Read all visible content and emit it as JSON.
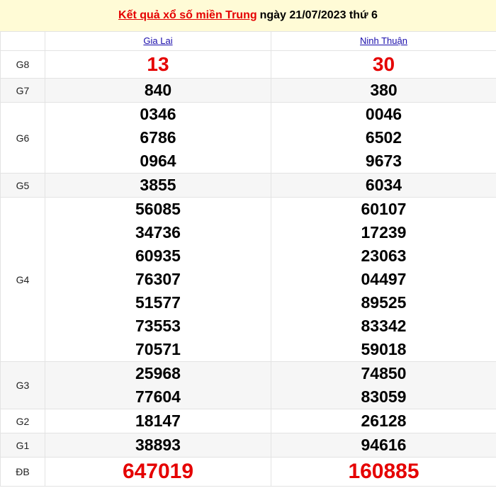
{
  "header": {
    "title_link": "Kết quả xổ số miền Trung",
    "title_rest": "ngày 21/07/2023 thứ 6"
  },
  "provinces": [
    "Gia Lai",
    "Ninh Thuận"
  ],
  "rows": [
    {
      "label": "G8",
      "a": [
        "13"
      ],
      "b": [
        "30"
      ]
    },
    {
      "label": "G7",
      "a": [
        "840"
      ],
      "b": [
        "380"
      ]
    },
    {
      "label": "G6",
      "a": [
        "0346",
        "6786",
        "0964"
      ],
      "b": [
        "0046",
        "6502",
        "9673"
      ]
    },
    {
      "label": "G5",
      "a": [
        "3855"
      ],
      "b": [
        "6034"
      ]
    },
    {
      "label": "G4",
      "a": [
        "56085",
        "34736",
        "60935",
        "76307",
        "51577",
        "73553",
        "70571"
      ],
      "b": [
        "60107",
        "17239",
        "23063",
        "04497",
        "89525",
        "83342",
        "59018"
      ]
    },
    {
      "label": "G3",
      "a": [
        "25968",
        "77604"
      ],
      "b": [
        "74850",
        "83059"
      ]
    },
    {
      "label": "G2",
      "a": [
        "18147"
      ],
      "b": [
        "26128"
      ]
    },
    {
      "label": "G1",
      "a": [
        "38893"
      ],
      "b": [
        "94616"
      ]
    },
    {
      "label": "ĐB",
      "a": [
        "647019"
      ],
      "b": [
        "160885"
      ]
    }
  ],
  "colors": {
    "accent_red": "#e50000",
    "link_blue": "#1a0dab",
    "header_bg": "#fffbd6"
  }
}
